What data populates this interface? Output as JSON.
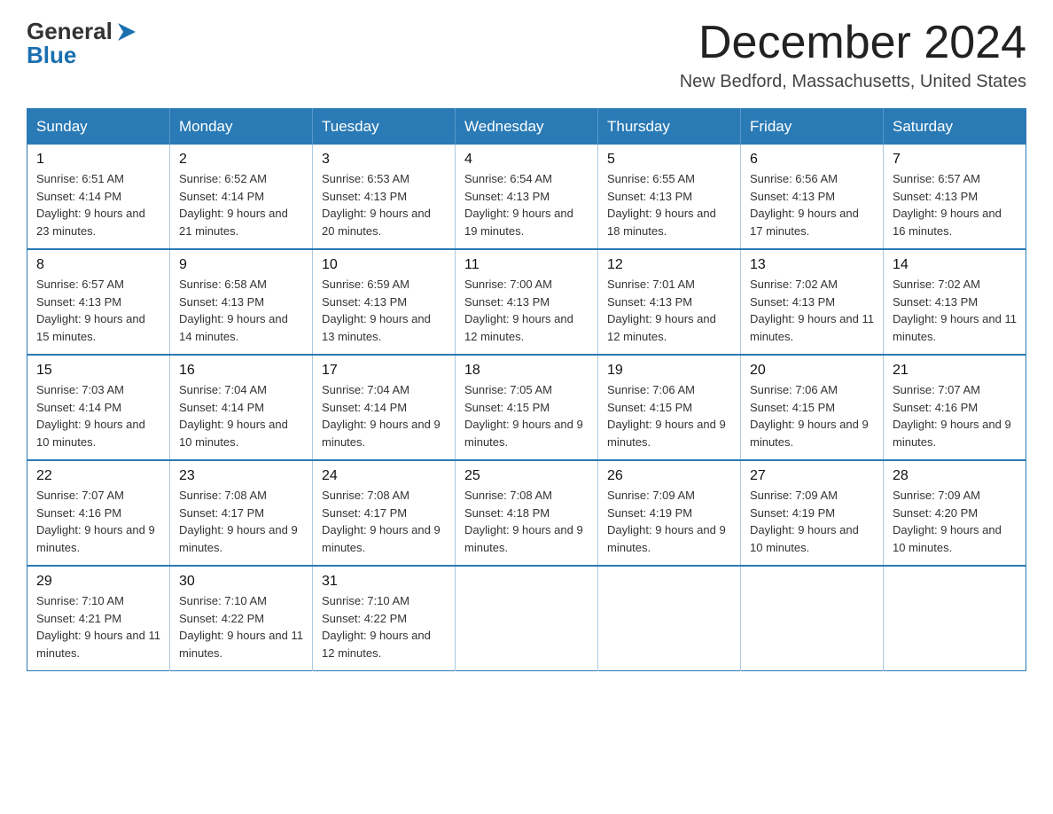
{
  "logo": {
    "text_general": "General",
    "text_blue": "Blue",
    "tagline": ""
  },
  "header": {
    "title": "December 2024",
    "subtitle": "New Bedford, Massachusetts, United States"
  },
  "weekdays": [
    "Sunday",
    "Monday",
    "Tuesday",
    "Wednesday",
    "Thursday",
    "Friday",
    "Saturday"
  ],
  "weeks": [
    [
      {
        "day": "1",
        "sunrise": "Sunrise: 6:51 AM",
        "sunset": "Sunset: 4:14 PM",
        "daylight": "Daylight: 9 hours and 23 minutes."
      },
      {
        "day": "2",
        "sunrise": "Sunrise: 6:52 AM",
        "sunset": "Sunset: 4:14 PM",
        "daylight": "Daylight: 9 hours and 21 minutes."
      },
      {
        "day": "3",
        "sunrise": "Sunrise: 6:53 AM",
        "sunset": "Sunset: 4:13 PM",
        "daylight": "Daylight: 9 hours and 20 minutes."
      },
      {
        "day": "4",
        "sunrise": "Sunrise: 6:54 AM",
        "sunset": "Sunset: 4:13 PM",
        "daylight": "Daylight: 9 hours and 19 minutes."
      },
      {
        "day": "5",
        "sunrise": "Sunrise: 6:55 AM",
        "sunset": "Sunset: 4:13 PM",
        "daylight": "Daylight: 9 hours and 18 minutes."
      },
      {
        "day": "6",
        "sunrise": "Sunrise: 6:56 AM",
        "sunset": "Sunset: 4:13 PM",
        "daylight": "Daylight: 9 hours and 17 minutes."
      },
      {
        "day": "7",
        "sunrise": "Sunrise: 6:57 AM",
        "sunset": "Sunset: 4:13 PM",
        "daylight": "Daylight: 9 hours and 16 minutes."
      }
    ],
    [
      {
        "day": "8",
        "sunrise": "Sunrise: 6:57 AM",
        "sunset": "Sunset: 4:13 PM",
        "daylight": "Daylight: 9 hours and 15 minutes."
      },
      {
        "day": "9",
        "sunrise": "Sunrise: 6:58 AM",
        "sunset": "Sunset: 4:13 PM",
        "daylight": "Daylight: 9 hours and 14 minutes."
      },
      {
        "day": "10",
        "sunrise": "Sunrise: 6:59 AM",
        "sunset": "Sunset: 4:13 PM",
        "daylight": "Daylight: 9 hours and 13 minutes."
      },
      {
        "day": "11",
        "sunrise": "Sunrise: 7:00 AM",
        "sunset": "Sunset: 4:13 PM",
        "daylight": "Daylight: 9 hours and 12 minutes."
      },
      {
        "day": "12",
        "sunrise": "Sunrise: 7:01 AM",
        "sunset": "Sunset: 4:13 PM",
        "daylight": "Daylight: 9 hours and 12 minutes."
      },
      {
        "day": "13",
        "sunrise": "Sunrise: 7:02 AM",
        "sunset": "Sunset: 4:13 PM",
        "daylight": "Daylight: 9 hours and 11 minutes."
      },
      {
        "day": "14",
        "sunrise": "Sunrise: 7:02 AM",
        "sunset": "Sunset: 4:13 PM",
        "daylight": "Daylight: 9 hours and 11 minutes."
      }
    ],
    [
      {
        "day": "15",
        "sunrise": "Sunrise: 7:03 AM",
        "sunset": "Sunset: 4:14 PM",
        "daylight": "Daylight: 9 hours and 10 minutes."
      },
      {
        "day": "16",
        "sunrise": "Sunrise: 7:04 AM",
        "sunset": "Sunset: 4:14 PM",
        "daylight": "Daylight: 9 hours and 10 minutes."
      },
      {
        "day": "17",
        "sunrise": "Sunrise: 7:04 AM",
        "sunset": "Sunset: 4:14 PM",
        "daylight": "Daylight: 9 hours and 9 minutes."
      },
      {
        "day": "18",
        "sunrise": "Sunrise: 7:05 AM",
        "sunset": "Sunset: 4:15 PM",
        "daylight": "Daylight: 9 hours and 9 minutes."
      },
      {
        "day": "19",
        "sunrise": "Sunrise: 7:06 AM",
        "sunset": "Sunset: 4:15 PM",
        "daylight": "Daylight: 9 hours and 9 minutes."
      },
      {
        "day": "20",
        "sunrise": "Sunrise: 7:06 AM",
        "sunset": "Sunset: 4:15 PM",
        "daylight": "Daylight: 9 hours and 9 minutes."
      },
      {
        "day": "21",
        "sunrise": "Sunrise: 7:07 AM",
        "sunset": "Sunset: 4:16 PM",
        "daylight": "Daylight: 9 hours and 9 minutes."
      }
    ],
    [
      {
        "day": "22",
        "sunrise": "Sunrise: 7:07 AM",
        "sunset": "Sunset: 4:16 PM",
        "daylight": "Daylight: 9 hours and 9 minutes."
      },
      {
        "day": "23",
        "sunrise": "Sunrise: 7:08 AM",
        "sunset": "Sunset: 4:17 PM",
        "daylight": "Daylight: 9 hours and 9 minutes."
      },
      {
        "day": "24",
        "sunrise": "Sunrise: 7:08 AM",
        "sunset": "Sunset: 4:17 PM",
        "daylight": "Daylight: 9 hours and 9 minutes."
      },
      {
        "day": "25",
        "sunrise": "Sunrise: 7:08 AM",
        "sunset": "Sunset: 4:18 PM",
        "daylight": "Daylight: 9 hours and 9 minutes."
      },
      {
        "day": "26",
        "sunrise": "Sunrise: 7:09 AM",
        "sunset": "Sunset: 4:19 PM",
        "daylight": "Daylight: 9 hours and 9 minutes."
      },
      {
        "day": "27",
        "sunrise": "Sunrise: 7:09 AM",
        "sunset": "Sunset: 4:19 PM",
        "daylight": "Daylight: 9 hours and 10 minutes."
      },
      {
        "day": "28",
        "sunrise": "Sunrise: 7:09 AM",
        "sunset": "Sunset: 4:20 PM",
        "daylight": "Daylight: 9 hours and 10 minutes."
      }
    ],
    [
      {
        "day": "29",
        "sunrise": "Sunrise: 7:10 AM",
        "sunset": "Sunset: 4:21 PM",
        "daylight": "Daylight: 9 hours and 11 minutes."
      },
      {
        "day": "30",
        "sunrise": "Sunrise: 7:10 AM",
        "sunset": "Sunset: 4:22 PM",
        "daylight": "Daylight: 9 hours and 11 minutes."
      },
      {
        "day": "31",
        "sunrise": "Sunrise: 7:10 AM",
        "sunset": "Sunset: 4:22 PM",
        "daylight": "Daylight: 9 hours and 12 minutes."
      },
      null,
      null,
      null,
      null
    ]
  ]
}
